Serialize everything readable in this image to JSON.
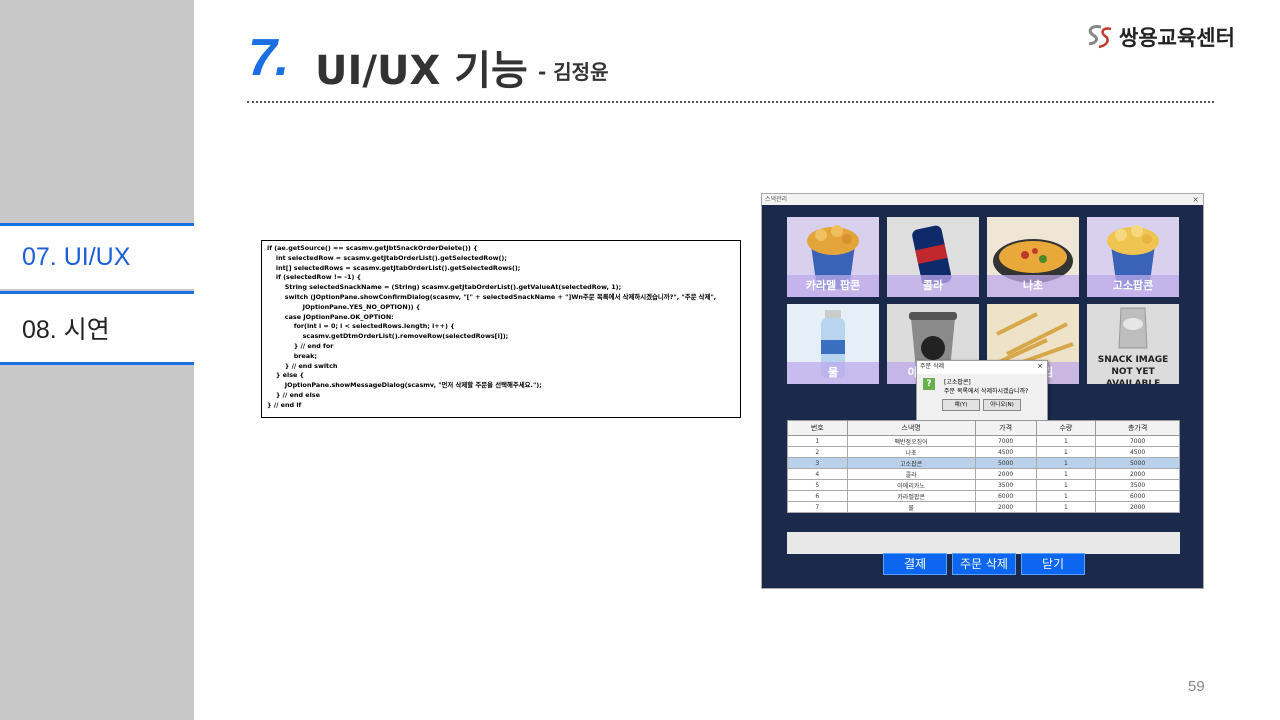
{
  "sidebar": {
    "items": [
      {
        "label": "07. UI/UX"
      },
      {
        "label": "08. 시연"
      }
    ]
  },
  "header": {
    "number": "7.",
    "title": "UI/UX 기능",
    "subtitle": "- 김정윤",
    "logo_text": "쌍용교육센터"
  },
  "code": {
    "lines": [
      "if (ae.getSource() == scasmv.getJbtSnackOrderDelete()) {",
      "    int selectedRow = scasmv.getJtabOrderList().getSelectedRow();",
      "    int[] selectedRows = scasmv.getJtabOrderList().getSelectedRows();",
      "",
      "    if (selectedRow != -1) {",
      "        String selectedSnackName = (String) scasmv.getJtabOrderList().getValueAt(selectedRow, 1);",
      "        switch (JOptionPane.showConfirmDialog(scasmv, \"[\" + selectedSnackName + \"]Wn주문 목록에서 삭제하시겠습니까?\", \"주문 삭제\",",
      "                JOptionPane.YES_NO_OPTION)) {",
      "        case JOptionPane.OK_OPTION:",
      "            for(int i = 0; i < selectedRows.length; i++) {",
      "                scasmv.getDtmOrderList().removeRow(selectedRows[i]);",
      "            } // end for",
      "            break;",
      "        } // end switch",
      "    } else {",
      "        JOptionPane.showMessageDialog(scasmv, \"먼저 삭제할 주문을 선택해주세요.\");",
      "    } // end else",
      "} // end if"
    ]
  },
  "app": {
    "window_title": "스낵관리",
    "close_glyph": "×",
    "snacks": [
      {
        "label": "카라멜 팝콘"
      },
      {
        "label": "콜라"
      },
      {
        "label": "나초"
      },
      {
        "label": "고소팝콘"
      },
      {
        "label": "물"
      },
      {
        "label": "아메리카노"
      },
      {
        "label": "감자튀김"
      },
      {
        "label": "SNACK IMAGE NOT YET AVAILABLE"
      }
    ],
    "table": {
      "headers": [
        "번호",
        "스낵명",
        "가격",
        "수량",
        "총가격"
      ],
      "rows": [
        [
          "1",
          "팩반점오징어",
          "7000",
          "1",
          "7000"
        ],
        [
          "2",
          "나초",
          "4500",
          "1",
          "4500"
        ],
        [
          "3",
          "고소팝콘",
          "5000",
          "1",
          "5000"
        ],
        [
          "4",
          "콜라",
          "2000",
          "1",
          "2000"
        ],
        [
          "5",
          "아메리카노",
          "3500",
          "1",
          "3500"
        ],
        [
          "6",
          "카라멜팝콘",
          "6000",
          "1",
          "6000"
        ],
        [
          "7",
          "물",
          "2000",
          "1",
          "2000"
        ]
      ],
      "selected_row_index": 2
    },
    "buttons": {
      "pay": "결제",
      "delete": "주문 삭제",
      "close": "닫기"
    },
    "dialog": {
      "title": "주문 삭제",
      "line1": "[고소팝콘]",
      "line2": "주문 목록에서 삭제하시겠습니까?",
      "yes": "예(Y)",
      "no": "아니오(N)"
    }
  },
  "page_number": "59",
  "colors": {
    "accent": "#1c6fe0",
    "app_bg": "#1b2a4a",
    "app_button": "#0d66f0"
  }
}
